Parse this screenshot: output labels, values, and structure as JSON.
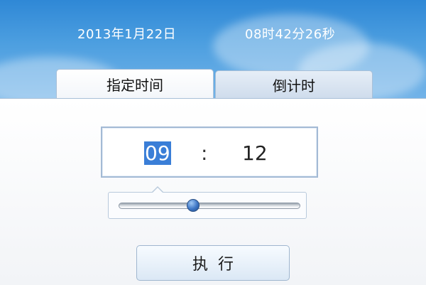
{
  "header": {
    "date": "2013年1月22日",
    "time": "08时42分26秒"
  },
  "tabs": [
    {
      "label": "指定时间",
      "active": true
    },
    {
      "label": "倒计时",
      "active": false
    }
  ],
  "time_picker": {
    "hour": "09",
    "separator": ":",
    "minute": "12",
    "hour_selected": true
  },
  "slider": {
    "value_fraction": 0.41
  },
  "execute_button": {
    "label": "执行"
  },
  "colors": {
    "header_blue": "#2f88d6",
    "selection_blue": "#3a7ed7",
    "border": "#a3bad5"
  }
}
